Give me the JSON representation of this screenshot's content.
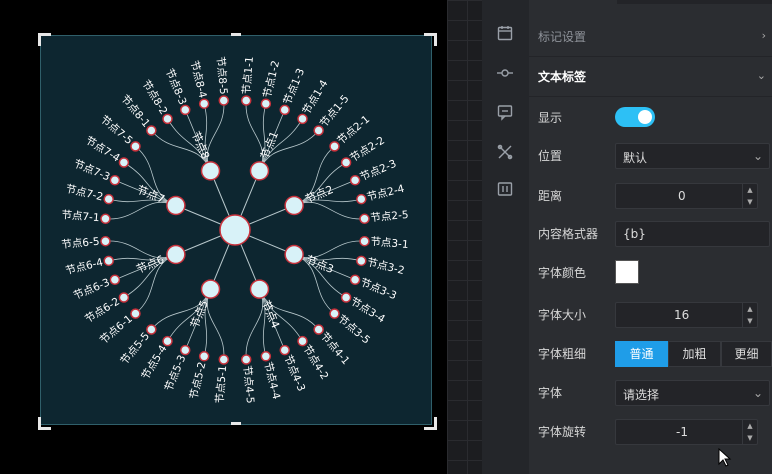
{
  "chart_data": {
    "type": "tree-radial",
    "root": {
      "name": "",
      "children": [
        {
          "name": "节点1",
          "children": [
            "节点1-1",
            "节点1-2",
            "节点1-3",
            "节点1-4",
            "节点1-5"
          ]
        },
        {
          "name": "节点2",
          "children": [
            "节点2-1",
            "节点2-2",
            "节点2-3",
            "节点2-4",
            "节点2-5"
          ]
        },
        {
          "name": "节点3",
          "children": [
            "节点3-1",
            "节点3-2",
            "节点3-3",
            "节点3-4",
            "节点3-5"
          ]
        },
        {
          "name": "节点4",
          "children": [
            "节点4-1",
            "节点4-2",
            "节点4-3",
            "节点4-4",
            "节点4-5"
          ]
        },
        {
          "name": "节点5",
          "children": [
            "节点5-1",
            "节点5-2",
            "节点5-3",
            "节点5-4",
            "节点5-5"
          ]
        },
        {
          "name": "节点6",
          "children": [
            "节点6-1",
            "节点6-2",
            "节点6-3",
            "节点6-4",
            "节点6-5"
          ]
        },
        {
          "name": "节点7",
          "children": [
            "节点7-1",
            "节点7-2",
            "节点7-3",
            "节点7-4",
            "节点7-5"
          ]
        },
        {
          "name": "节点8",
          "children": [
            "节点8-1",
            "节点8-2",
            "节点8-3",
            "节点8-4",
            "节点8-5"
          ]
        }
      ]
    },
    "colors": {
      "node_fill": "#d8f2f8",
      "node_stroke": "#c8323c",
      "link": "#b8c8cc",
      "label": "#ffffff",
      "background": "#0d2630"
    }
  },
  "panel": {
    "marker_settings": "标记设置",
    "text_label": "文本标签",
    "rows": {
      "show": {
        "label": "显示",
        "value": true
      },
      "position": {
        "label": "位置",
        "value": "默认"
      },
      "distance": {
        "label": "距离",
        "value": "0"
      },
      "formatter": {
        "label": "内容格式器",
        "value": "{b}"
      },
      "font_color": {
        "label": "字体颜色",
        "value": "#ffffff"
      },
      "font_size": {
        "label": "字体大小",
        "value": "16"
      },
      "font_weight": {
        "label": "字体粗细",
        "options": [
          "普通",
          "加粗",
          "更细"
        ],
        "selected": "普通"
      },
      "font_family": {
        "label": "字体",
        "value": "请选择"
      },
      "font_rotate": {
        "label": "字体旋转",
        "value": "-1"
      }
    }
  },
  "icons": [
    "calendar-icon",
    "git-commit-icon",
    "message-icon",
    "tools-icon",
    "code-box-icon"
  ],
  "accent": "#2dc0f5"
}
